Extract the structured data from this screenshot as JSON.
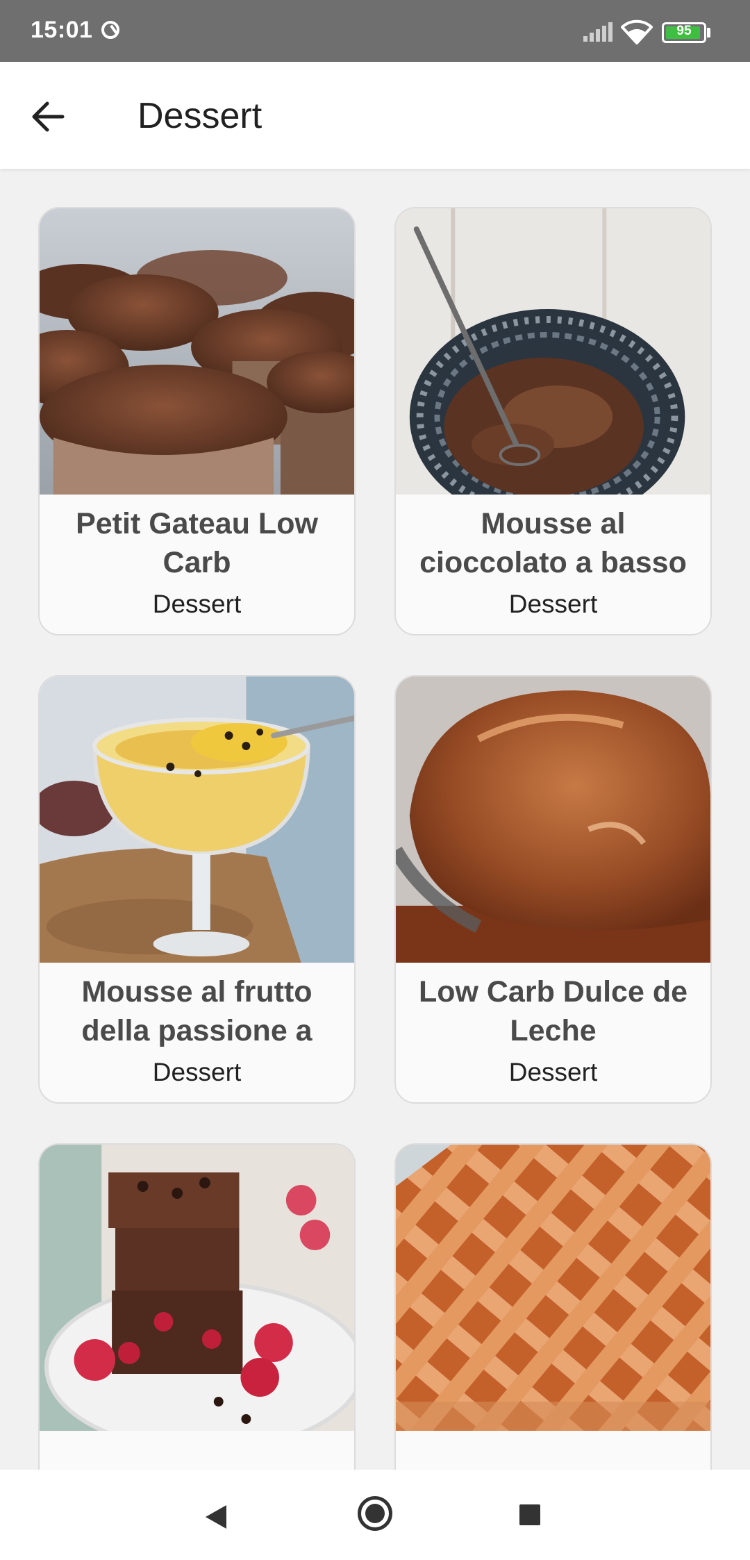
{
  "status_bar": {
    "time": "15:01",
    "battery": "95"
  },
  "app_bar": {
    "title": "Dessert"
  },
  "cards": [
    {
      "title": "Petit Gateau Low Carb",
      "category": "Dessert",
      "image": "chocolate-muffins"
    },
    {
      "title": "Mousse al cioccolato a basso",
      "category": "Dessert",
      "image": "chocolate-mousse-bowl"
    },
    {
      "title": "Mousse al frutto della passione a",
      "category": "Dessert",
      "image": "passion-fruit-mousse"
    },
    {
      "title": "Low Carb Dulce de Leche",
      "category": "Dessert",
      "image": "dulce-de-leche"
    },
    {
      "title": "",
      "category": "",
      "image": "chocolate-brownies"
    },
    {
      "title": "",
      "category": "",
      "image": "lattice-crostata"
    }
  ]
}
